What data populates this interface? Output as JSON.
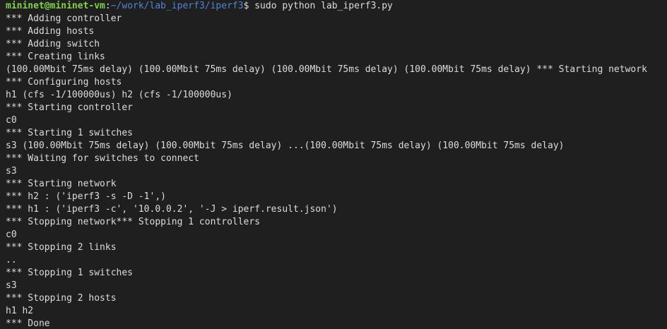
{
  "prompt": {
    "user_host": "mininet@mininet-vm",
    "separator": ":",
    "path": "~/work/lab_iperf3/iperf3",
    "symbol": "$ ",
    "command": "sudo python lab_iperf3.py"
  },
  "output_lines": [
    "*** Adding controller",
    "*** Adding hosts",
    "*** Adding switch",
    "*** Creating links",
    "(100.00Mbit 75ms delay) (100.00Mbit 75ms delay) (100.00Mbit 75ms delay) (100.00Mbit 75ms delay) *** Starting network",
    "*** Configuring hosts",
    "h1 (cfs -1/100000us) h2 (cfs -1/100000us)",
    "*** Starting controller",
    "c0",
    "*** Starting 1 switches",
    "s3 (100.00Mbit 75ms delay) (100.00Mbit 75ms delay) ...(100.00Mbit 75ms delay) (100.00Mbit 75ms delay)",
    "*** Waiting for switches to connect",
    "s3",
    "*** Starting network",
    "*** h2 : ('iperf3 -s -D -1',)",
    "*** h1 : ('iperf3 -c', '10.0.0.2', '-J > iperf.result.json')",
    "*** Stopping network*** Stopping 1 controllers",
    "c0",
    "*** Stopping 2 links",
    "..",
    "*** Stopping 1 switches",
    "s3",
    "*** Stopping 2 hosts",
    "h1 h2",
    "*** Done"
  ],
  "colors": {
    "background": "#1f1f1f",
    "text": "#dcdcdc",
    "user_host": "#7fd44a",
    "path": "#4f86d9"
  }
}
